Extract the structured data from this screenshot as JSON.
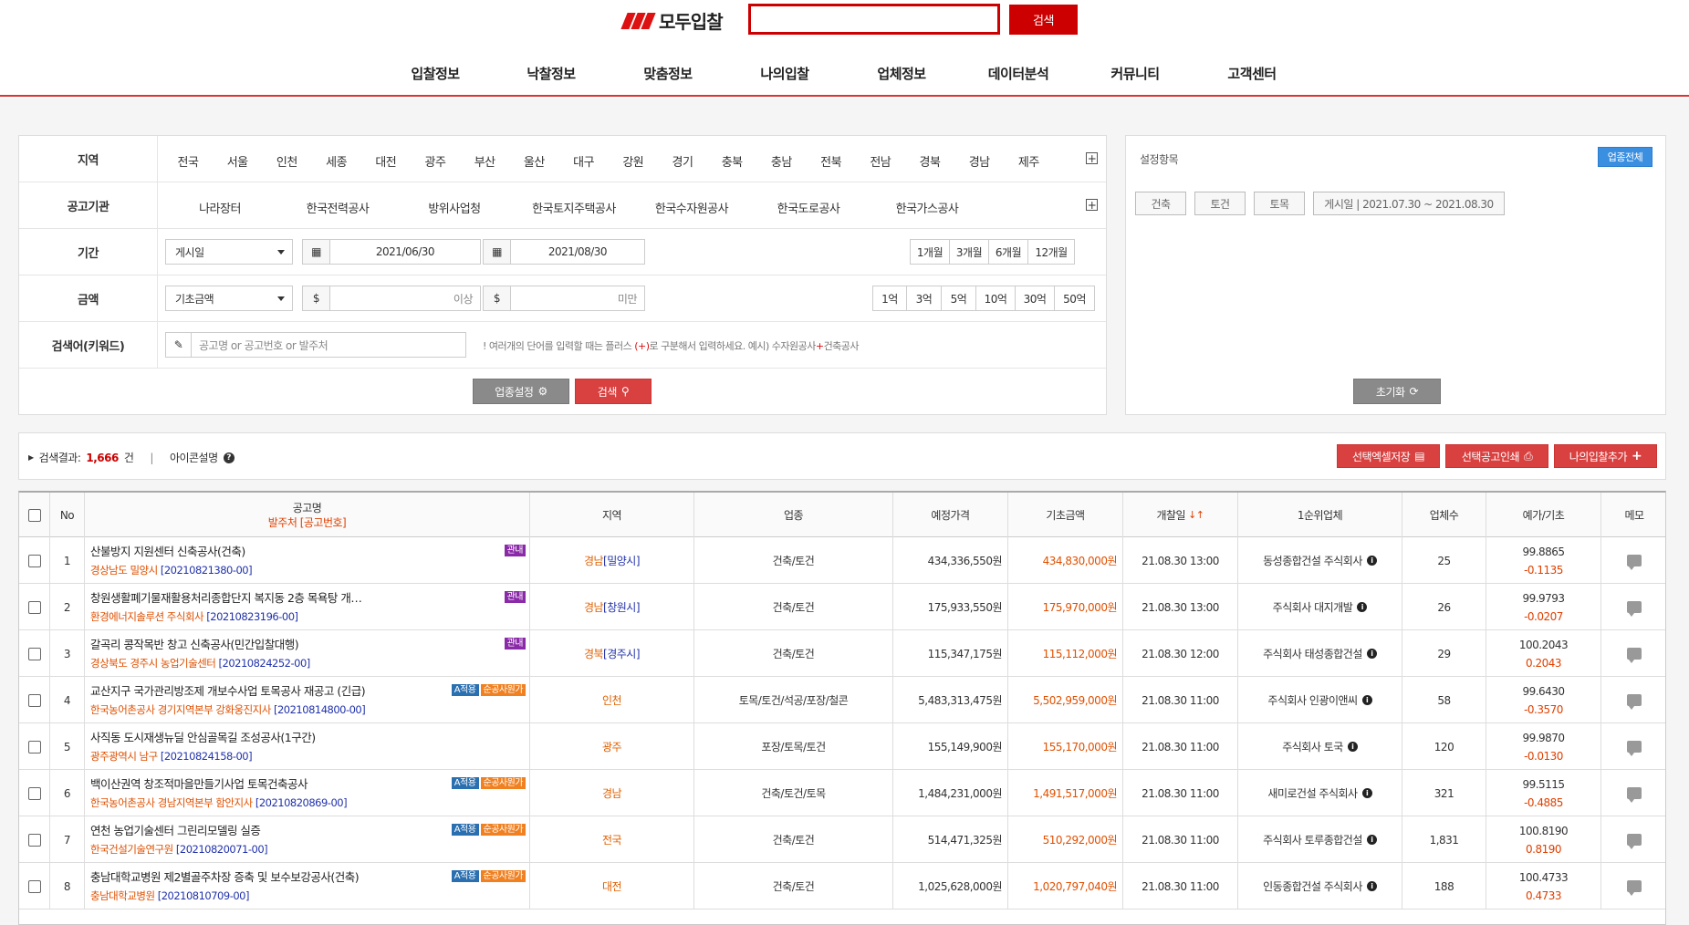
{
  "header": {
    "logo_text": "모두입찰",
    "search_button": "검색",
    "nav": [
      "입찰정보",
      "낙찰정보",
      "맞춤정보",
      "나의입찰",
      "업체정보",
      "데이터분석",
      "커뮤니티",
      "고객센터"
    ]
  },
  "filters": {
    "region_label": "지역",
    "regions": [
      "전국",
      "서울",
      "인천",
      "세종",
      "대전",
      "광주",
      "부산",
      "울산",
      "대구",
      "강원",
      "경기",
      "충북",
      "충남",
      "전북",
      "전남",
      "경북",
      "경남",
      "제주"
    ],
    "agency_label": "공고기관",
    "agencies": [
      "나라장터",
      "한국전력공사",
      "방위사업청",
      "한국토지주택공사",
      "한국수자원공사",
      "한국도로공사",
      "한국가스공사"
    ],
    "period_label": "기간",
    "period_select": "게시일",
    "date_from": "2021/06/30",
    "date_to": "2021/08/30",
    "tilde": "~",
    "period_buttons": [
      "1개월",
      "3개월",
      "6개월",
      "12개월"
    ],
    "amount_label": "금액",
    "amount_select": "기초금액",
    "amount_min_placeholder": "이상",
    "amount_max_placeholder": "미만",
    "amount_buttons": [
      "1억",
      "3억",
      "5억",
      "10억",
      "30억",
      "50억"
    ],
    "keyword_label": "검색어(키워드)",
    "keyword_placeholder": "공고명 or 공고번호 or 발주처",
    "hint_prefix": "! 여러개의 단어를 입력할 때는 플러스 ",
    "hint_plus": "(+)",
    "hint_mid": "로 구분해서 입력하세요. 예시) 수자원공사",
    "hint_plus2": "+",
    "hint_suffix": "건축공사",
    "sector_button": "업종설정",
    "search_button": "검색"
  },
  "settings": {
    "title": "설정항목",
    "all_button": "업종전체",
    "tags": [
      "건축",
      "토건",
      "토목",
      "게시일 | 2021.07.30 ~ 2021.08.30"
    ],
    "reset_button": "초기화"
  },
  "toolbar": {
    "result_label": "검색결과:",
    "result_count": "1,666",
    "result_unit": "건",
    "separator": "|",
    "icon_help": "아이콘설명",
    "excel_button": "선택엑셀저장",
    "print_button": "선택공고인쇄",
    "add_button": "나의입찰추가"
  },
  "table": {
    "headers": {
      "no": "No",
      "title": "공고명",
      "title_sub": "발주처 [공고번호]",
      "region": "지역",
      "sector": "업종",
      "estimated": "예정가격",
      "base": "기초금액",
      "open_date": "개찰일",
      "winner": "1순위업체",
      "count": "업체수",
      "ratio": "예가/기초",
      "memo": "메모"
    },
    "rows": [
      {
        "no": "1",
        "title": "산불방지 지원센터 신축공사(건축)",
        "agency": "경상남도 밀양시",
        "num": "[20210821380-00]",
        "badges": [
          {
            "text": "관내",
            "color": "purple"
          }
        ],
        "region_main": "경남",
        "region_sub": "[밀양시]",
        "sector": "건축/토건",
        "estimated": "434,336,550원",
        "base": "434,830,000원",
        "open": "21.08.30 13:00",
        "winner": "동성종합건설 주식회사",
        "count": "25",
        "ratio": "99.8865",
        "diff": "-0.1135"
      },
      {
        "no": "2",
        "title": "창원생활폐기물재활용처리종합단지 복지동 2층 목욕탕 개…",
        "agency": "환경에너지솔루션 주식회사",
        "num": "[20210823196-00]",
        "badges": [
          {
            "text": "관내",
            "color": "purple"
          }
        ],
        "region_main": "경남",
        "region_sub": "[창원시]",
        "sector": "건축/토건",
        "estimated": "175,933,550원",
        "base": "175,970,000원",
        "open": "21.08.30 13:00",
        "winner": "주식회사 대지개발",
        "count": "26",
        "ratio": "99.9793",
        "diff": "-0.0207"
      },
      {
        "no": "3",
        "title": "갈곡리 콩작목반 창고 신축공사(민간입찰대행)",
        "agency": "경상북도 경주시 농업기술센터",
        "num": "[20210824252-00]",
        "badges": [
          {
            "text": "관내",
            "color": "purple"
          }
        ],
        "region_main": "경북",
        "region_sub": "[경주시]",
        "sector": "건축/토건",
        "estimated": "115,347,175원",
        "base": "115,112,000원",
        "open": "21.08.30 12:00",
        "winner": "주식회사 태성종합건설",
        "count": "29",
        "ratio": "100.2043",
        "diff": "0.2043"
      },
      {
        "no": "4",
        "title": "교산지구 국가관리방조제 개보수사업 토목공사 재공고 (긴급)",
        "agency": "한국농어촌공사 경기지역본부 강화웅진지사",
        "num": "[20210814800-00]",
        "badges": [
          {
            "text": "A적용",
            "color": "blue"
          },
          {
            "text": "순공사원가",
            "color": "orange"
          }
        ],
        "region_main": "인천",
        "region_sub": "",
        "sector": "토목/토건/석공/포장/철콘",
        "estimated": "5,483,313,475원",
        "base": "5,502,959,000원",
        "open": "21.08.30 11:00",
        "winner": "주식회사 인광이앤씨",
        "count": "58",
        "ratio": "99.6430",
        "diff": "-0.3570"
      },
      {
        "no": "5",
        "title": "사직동 도시재생뉴딜 안심골목길 조성공사(1구간)",
        "agency": "광주광역시 남구",
        "num": "[20210824158-00]",
        "badges": [],
        "region_main": "광주",
        "region_sub": "",
        "sector": "포장/토목/토건",
        "estimated": "155,149,900원",
        "base": "155,170,000원",
        "open": "21.08.30 11:00",
        "winner": "주식회사 토국",
        "count": "120",
        "ratio": "99.9870",
        "diff": "-0.0130"
      },
      {
        "no": "6",
        "title": "백이산권역 창조적마을만들기사업 토목건축공사",
        "agency": "한국농어촌공사 경남지역본부 함안지사",
        "num": "[20210820869-00]",
        "badges": [
          {
            "text": "A적용",
            "color": "blue"
          },
          {
            "text": "순공사원가",
            "color": "orange"
          }
        ],
        "region_main": "경남",
        "region_sub": "",
        "sector": "건축/토건/토목",
        "estimated": "1,484,231,000원",
        "base": "1,491,517,000원",
        "open": "21.08.30 11:00",
        "winner": "새미로건설 주식회사",
        "count": "321",
        "ratio": "99.5115",
        "diff": "-0.4885"
      },
      {
        "no": "7",
        "title": "연천 농업기술센터 그린리모델링 실증",
        "agency": "한국건설기술연구원",
        "num": "[20210820071-00]",
        "badges": [
          {
            "text": "A적용",
            "color": "blue"
          },
          {
            "text": "순공사원가",
            "color": "orange"
          }
        ],
        "region_main": "전국",
        "region_sub": "",
        "sector": "건축/토건",
        "estimated": "514,471,325원",
        "base": "510,292,000원",
        "open": "21.08.30 11:00",
        "winner": "주식회사 토루종합건설",
        "count": "1,831",
        "ratio": "100.8190",
        "diff": "0.8190"
      },
      {
        "no": "8",
        "title": "충남대학교병원 제2별골주차장 증축 및 보수보강공사(건축)",
        "agency": "충남대학교병원",
        "num": "[20210810709-00]",
        "badges": [
          {
            "text": "A적용",
            "color": "blue"
          },
          {
            "text": "순공사원가",
            "color": "orange"
          }
        ],
        "region_main": "대전",
        "region_sub": "",
        "sector": "건축/토건",
        "estimated": "1,025,628,000원",
        "base": "1,020,797,040원",
        "open": "21.08.30 11:00",
        "winner": "인동종합건설 주식회사",
        "count": "188",
        "ratio": "100.4733",
        "diff": "0.4733"
      }
    ]
  }
}
